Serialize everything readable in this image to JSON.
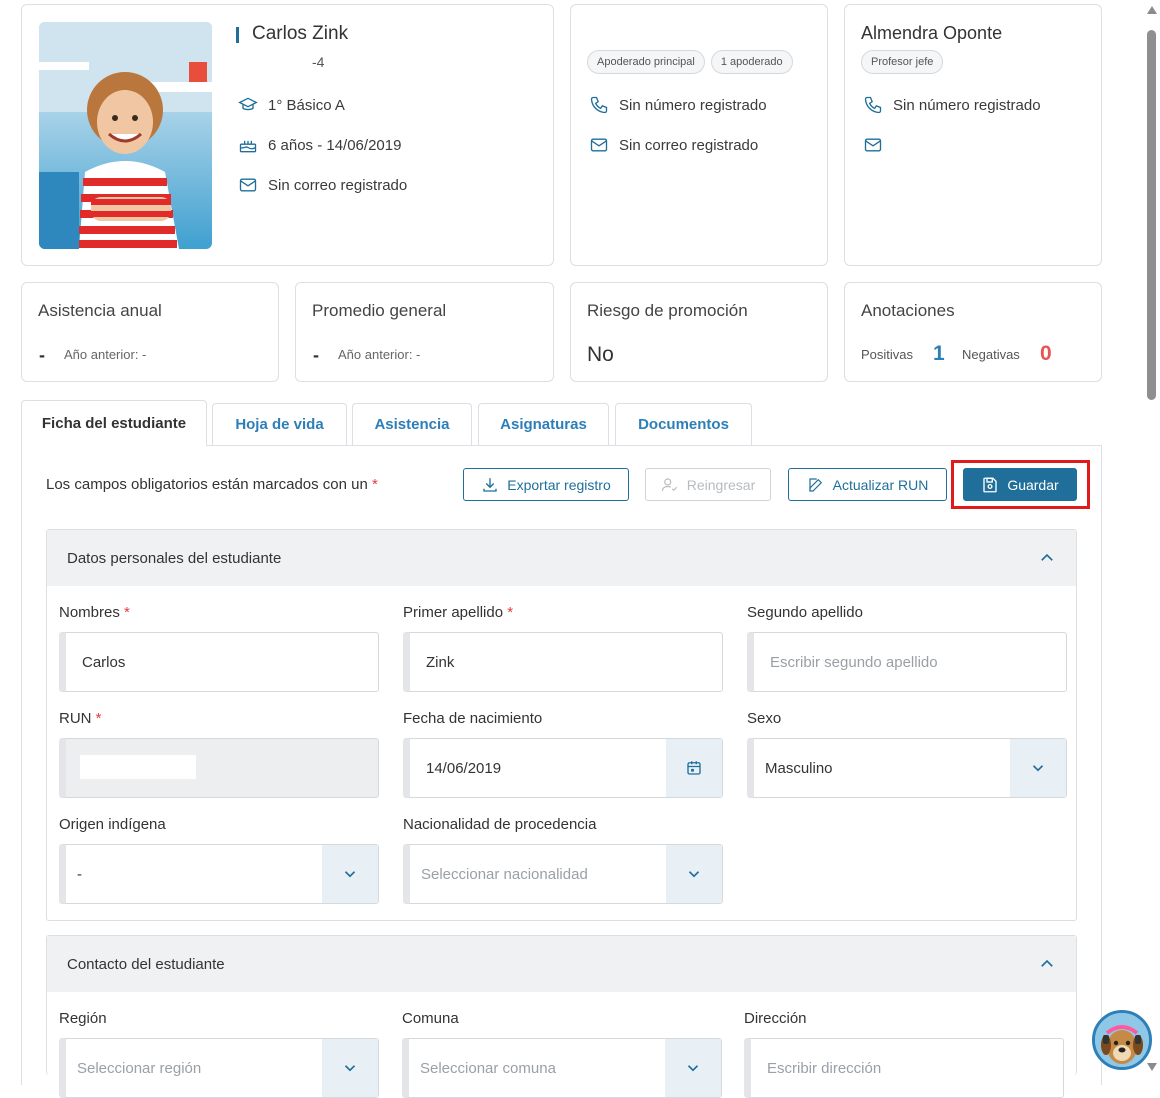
{
  "student": {
    "name": "Carlos Zink",
    "run_partial": "-4",
    "course": "1° Básico A",
    "age_birth": "6 años - 14/06/2019",
    "email": "Sin correo registrado"
  },
  "guardian": {
    "chips": [
      "Apoderado principal",
      "1 apoderado"
    ],
    "phone": "Sin número registrado",
    "email": "Sin correo registrado"
  },
  "teacher": {
    "name": "Almendra Oponte",
    "chip": "Profesor jefe",
    "phone": "Sin número registrado"
  },
  "stats": {
    "attendance": {
      "title": "Asistencia anual",
      "value": "-",
      "prev": "Año anterior: -"
    },
    "average": {
      "title": "Promedio general",
      "value": "-",
      "prev": "Año anterior: -"
    },
    "risk": {
      "title": "Riesgo de promoción",
      "value": "No"
    },
    "notes": {
      "title": "Anotaciones",
      "positive_label": "Positivas",
      "positive": "1",
      "negative_label": "Negativas",
      "negative": "0"
    }
  },
  "tabs": [
    "Ficha del estudiante",
    "Hoja de vida",
    "Asistencia",
    "Asignaturas",
    "Documentos"
  ],
  "toolbar": {
    "required_note": "Los campos obligatorios están marcados con un",
    "required_mark": "*",
    "export": "Exportar registro",
    "reenter": "Reingresar",
    "update_run": "Actualizar RUN",
    "save": "Guardar"
  },
  "personal": {
    "title": "Datos personales del estudiante",
    "nombres_label": "Nombres",
    "nombres": "Carlos",
    "primer_label": "Primer apellido",
    "primer": "Zink",
    "segundo_label": "Segundo apellido",
    "segundo_ph": "Escribir segundo apellido",
    "run_label": "RUN",
    "fecha_label": "Fecha de nacimiento",
    "fecha": "14/06/2019",
    "sexo_label": "Sexo",
    "sexo": "Masculino",
    "origen_label": "Origen indígena",
    "origen": "-",
    "nac_label": "Nacionalidad de procedencia",
    "nac_ph": "Seleccionar nacionalidad"
  },
  "contact": {
    "title": "Contacto del estudiante",
    "region_label": "Región",
    "region_ph": "Seleccionar región",
    "comuna_label": "Comuna",
    "comuna_ph": "Seleccionar comuna",
    "dir_label": "Dirección",
    "dir_ph": "Escribir dirección"
  },
  "colors": {
    "accent": "#1f6f9a",
    "required": "#e23c3c",
    "positive": "#2d7fb8",
    "negative": "#e85454",
    "highlight": "#e01b1b"
  }
}
